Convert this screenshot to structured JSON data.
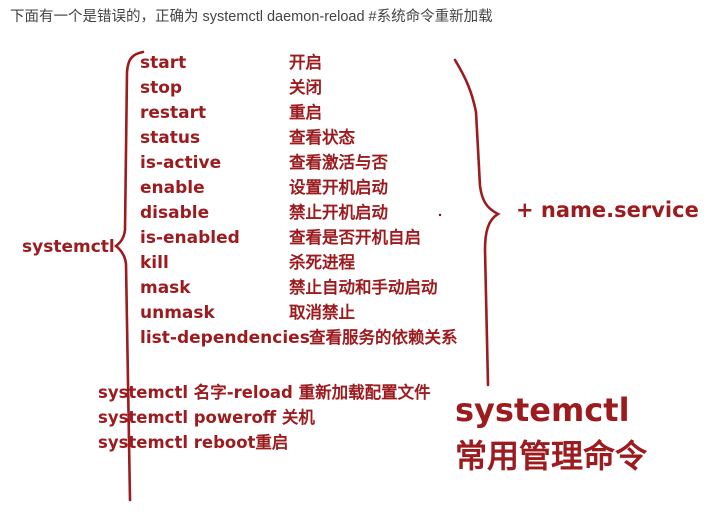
{
  "caption": "下面有一个是错误的，正确为 systemctl daemon-reload #系统命令重新加载",
  "root_label": "systemctl",
  "commands": [
    {
      "cmd": "start",
      "desc": "开启"
    },
    {
      "cmd": "stop",
      "desc": "关闭"
    },
    {
      "cmd": "restart",
      "desc": "重启"
    },
    {
      "cmd": "status",
      "desc": "查看状态"
    },
    {
      "cmd": "is-active",
      "desc": "查看激活与否"
    },
    {
      "cmd": "enable",
      "desc": "设置开机启动"
    },
    {
      "cmd": "disable",
      "desc": "禁止开机启动"
    },
    {
      "cmd": "is-enabled",
      "desc": "查看是否开机自启"
    },
    {
      "cmd": "kill",
      "desc": "杀死进程"
    },
    {
      "cmd": "mask",
      "desc": "禁止自动和手动启动"
    },
    {
      "cmd": "unmask",
      "desc": "取消禁止"
    },
    {
      "cmd": "list-dependencies",
      "desc": "查看服务的依赖关系"
    }
  ],
  "service_suffix": "+ name.service",
  "extra_commands": [
    "systemctl 名字-reload 重新加载配置文件",
    "systemctl poweroff 关机",
    "systemctl reboot重启"
  ],
  "big_title": {
    "line1": "systemctl",
    "line2": "常用管理命令"
  },
  "colors": {
    "ink": "#9b1b1e",
    "caption": "#444444"
  }
}
